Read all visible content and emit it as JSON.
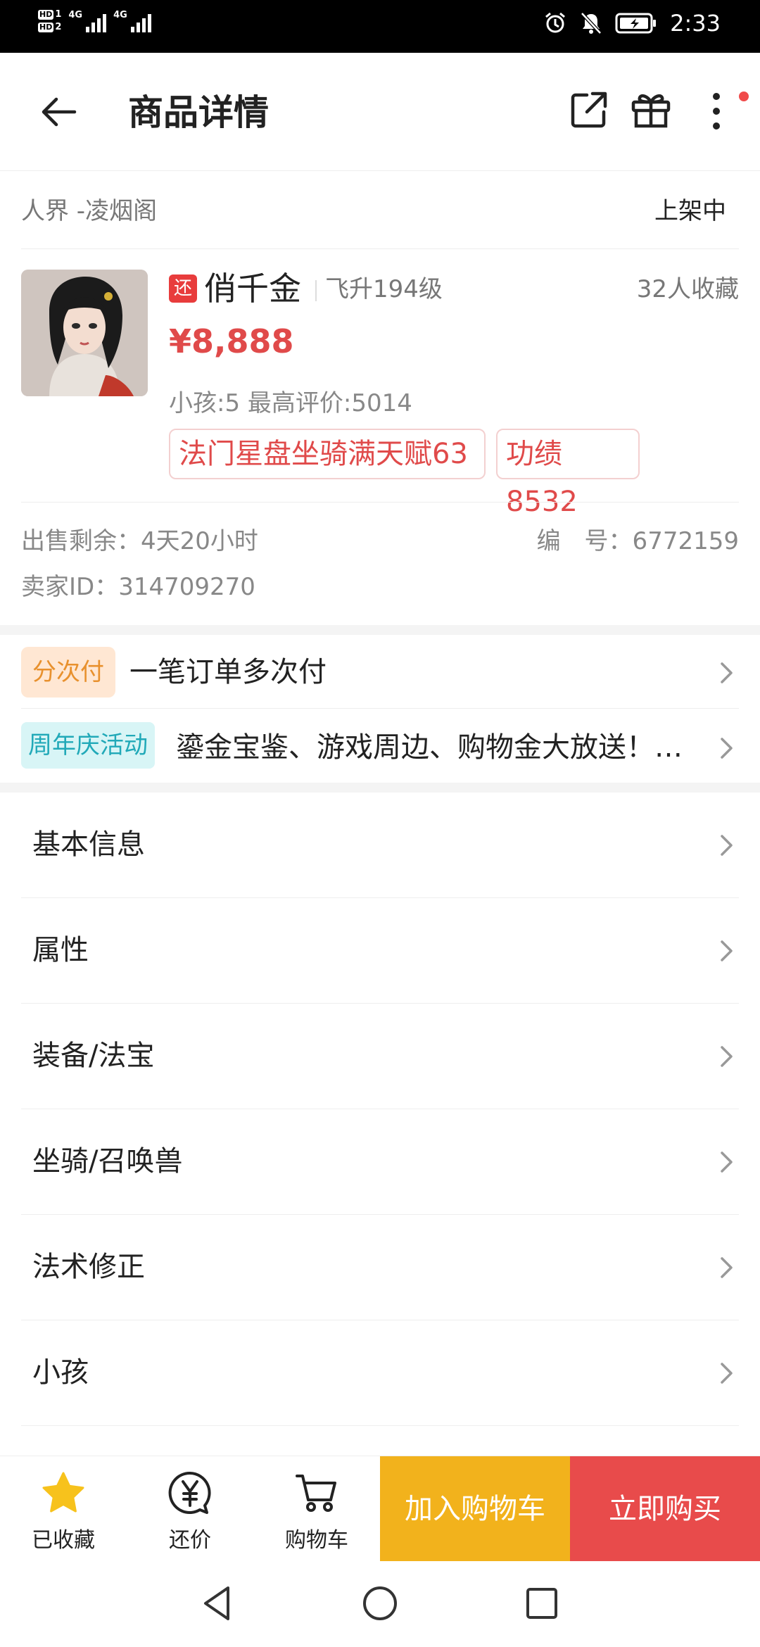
{
  "status_bar": {
    "network1": "4G",
    "network2": "4G",
    "time": "2:33"
  },
  "header": {
    "title": "商品详情"
  },
  "listing": {
    "server": "人界 -凌烟阁",
    "status": "上架中",
    "bargain_badge": "还",
    "name": "俏千金",
    "level": "飞升194级",
    "favorites": "32人收藏",
    "price": "¥8,888",
    "stats": "小孩:5  最高评价:5014",
    "tags": [
      "法门星盘坐骑满天赋63",
      "功绩8532"
    ],
    "sale_remaining": "出售剩余：4天20小时",
    "item_number": "编　号：6772159",
    "seller_id": "卖家ID：314709270"
  },
  "promos": [
    {
      "badge": "分次付",
      "text": "一笔订单多次付"
    },
    {
      "badge": "周年庆活动",
      "text": "鎏金宝鉴、游戏周边、购物金大放送！…"
    }
  ],
  "sections": [
    {
      "label": "基本信息"
    },
    {
      "label": "属性"
    },
    {
      "label": "装备/法宝"
    },
    {
      "label": "坐骑/召唤兽"
    },
    {
      "label": "法术修正"
    },
    {
      "label": "小孩"
    }
  ],
  "bottom_bar": {
    "favorite_label": "已收藏",
    "bargain_label": "还价",
    "cart_label": "购物车",
    "add_to_cart": "加入购物车",
    "buy_now": "立即购买"
  },
  "colors": {
    "accent_red": "#e84b4b",
    "accent_yellow": "#f2b21c",
    "price_red": "#e04a4a"
  },
  "icons": [
    "back-arrow-icon",
    "share-icon",
    "gift-icon",
    "more-vert-icon",
    "star-icon",
    "yuan-bubble-icon",
    "cart-icon",
    "nav-back-icon",
    "nav-home-icon",
    "nav-recents-icon"
  ]
}
